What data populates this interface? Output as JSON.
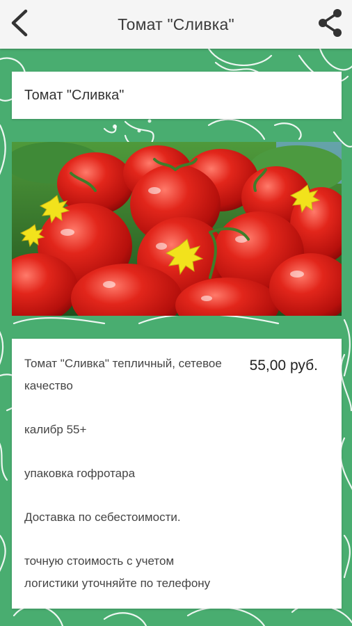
{
  "header": {
    "title": "Томат \"Сливка\"",
    "back_icon": "chevron-left-icon",
    "share_icon": "share-icon"
  },
  "product": {
    "name": "Томат \"Сливка\"",
    "price": "55,00 руб.",
    "description": [
      "Томат \"Сливка\" тепличный, сетевое качество",
      "калибр 55+",
      "упаковка гофротара",
      "Доставка по себестоимости.",
      "точную стоимость с учетом логистики уточняйте по телефону"
    ]
  },
  "colors": {
    "background": "#49ad70",
    "header": "#f5f5f5",
    "card": "#ffffff"
  }
}
